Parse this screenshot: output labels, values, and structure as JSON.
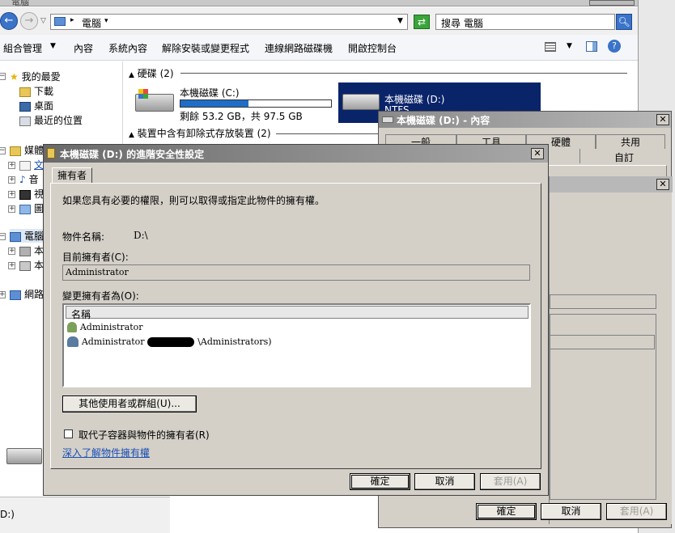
{
  "explorer": {
    "title": "電腦",
    "breadcrumb": "電腦",
    "search_placeholder": "搜尋 電腦",
    "toolbar": [
      "組合管理",
      "內容",
      "系統內容",
      "解除安裝或變更程式",
      "連線網路磁碟機",
      "開啟控制台"
    ],
    "nav": {
      "favorites": "我的最愛",
      "downloads": "下載",
      "desktop": "桌面",
      "recent": "最近的位置",
      "libraries": "媒體",
      "lib_items": [
        "文",
        "音",
        "視",
        "圖"
      ],
      "computer": "電腦",
      "comp_items": [
        "本",
        "本"
      ],
      "network": "網路"
    },
    "hdd_group": "硬碟 (2)",
    "drive_c": {
      "name": "本機磁碟 (C:)",
      "free": "剩餘 53.2 GB，共 97.5 GB",
      "used_fraction": 0.45
    },
    "drive_d": {
      "name": "本機磁碟 (D:)",
      "fs": "NTFS"
    },
    "removable_group": "裝置中含有卸除式存放裝置 (2)",
    "status": "D:)"
  },
  "props": {
    "title": "本機磁碟 (D:) - 內容",
    "tabs_row1": [
      "一般",
      "工具",
      "硬體",
      "共用"
    ],
    "tabs_row2": [
      "",
      "",
      "自訂"
    ],
    "ok": "確定",
    "cancel": "取消",
    "apply": "套用(A)"
  },
  "adv": {
    "title": "本機磁碟 (D:) 的進階安全性設定",
    "tab": "擁有者",
    "intro": "如果您具有必要的權限，則可以取得或指定此物件的擁有權。",
    "object_label": "物件名稱:",
    "object_value": "D:\\",
    "current_owner_label": "目前擁有者(C):",
    "current_owner_value": "Administrator",
    "change_label": "變更擁有者為(O):",
    "list_header": "名稱",
    "list_items": [
      "Administrator",
      "Administrator"
    ],
    "list_item2_suffix": "\\Administrators)",
    "other_users_btn": "其他使用者或群組(U)...",
    "replace_checkbox": "取代子容器與物件的擁有者(R)",
    "learn_link": "深入了解物件擁有權",
    "ok": "確定",
    "cancel": "取消",
    "apply": "套用(A)"
  }
}
